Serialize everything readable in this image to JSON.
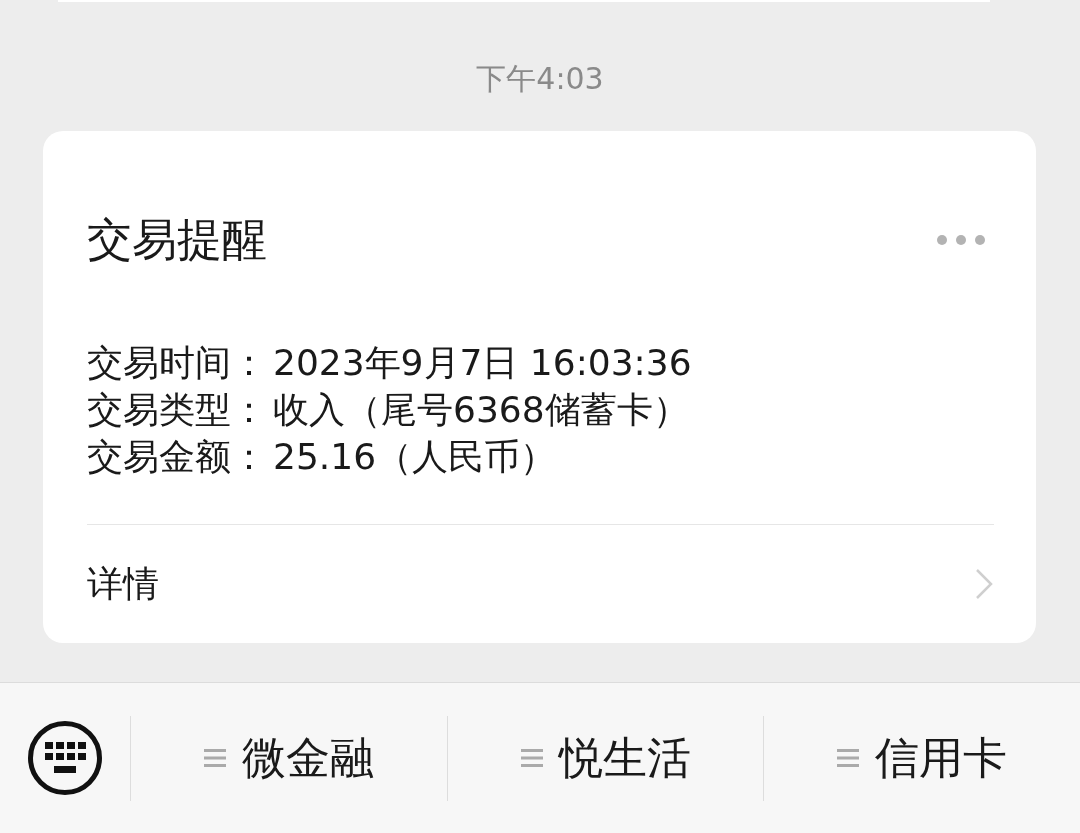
{
  "timestamp": "下午4:03",
  "card": {
    "title": "交易提醒",
    "fields": [
      {
        "label": "交易时间：",
        "value": "2023年9月7日 16:03:36"
      },
      {
        "label": "交易类型：",
        "value": "收入（尾号6368储蓄卡）"
      },
      {
        "label": "交易金额：",
        "value": "25.16（人民币）"
      }
    ],
    "link": "详情"
  },
  "menu_bar": {
    "items": [
      {
        "label": "微金融"
      },
      {
        "label": "悦生活"
      },
      {
        "label": "信用卡"
      }
    ]
  }
}
